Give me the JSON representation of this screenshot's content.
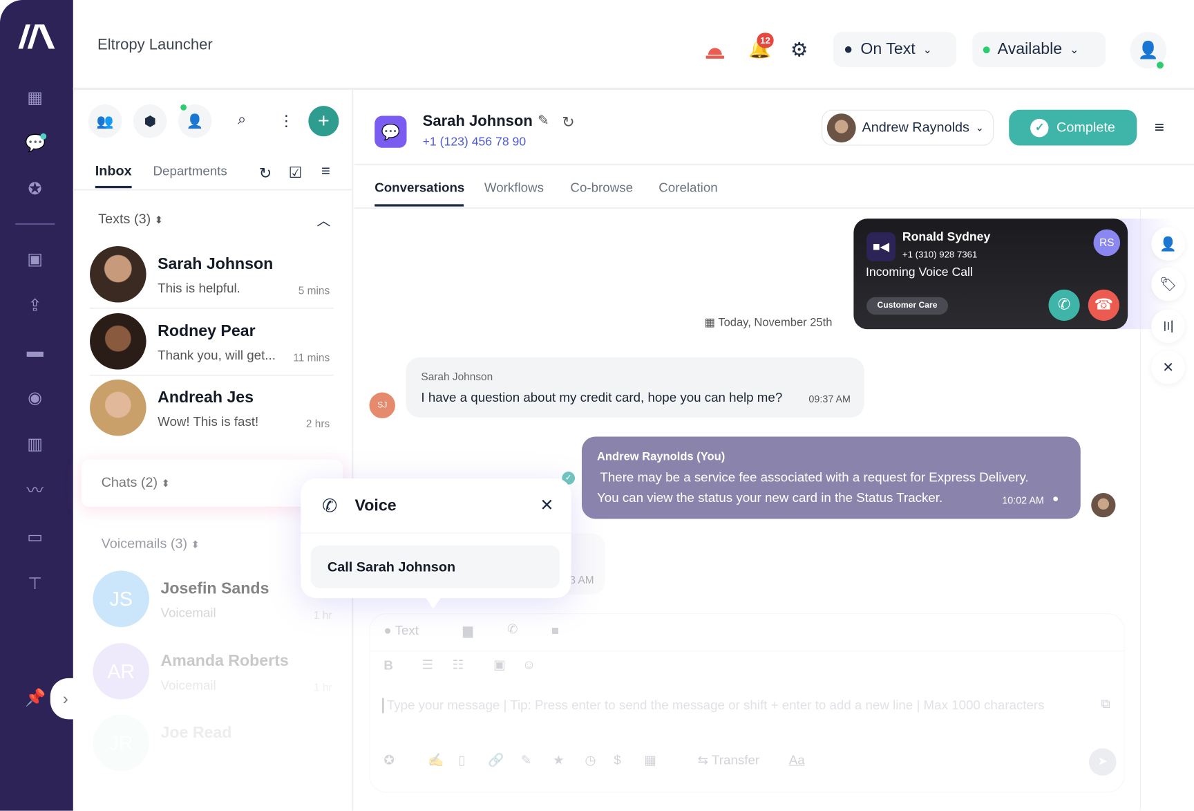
{
  "app": {
    "title": "Eltropy Launcher"
  },
  "header": {
    "notification_count": "12",
    "channel_mode": "On Text",
    "status": "Available",
    "status_color": "#2ecc71"
  },
  "left_panel": {
    "tabs": [
      "Inbox",
      "Departments"
    ],
    "texts_section": "Texts (3)",
    "texts": [
      {
        "name": "Sarah Johnson",
        "message": "This is helpful.",
        "time": "5 mins"
      },
      {
        "name": "Rodney Pear",
        "message": "Thank you, will get...",
        "time": "11 mins"
      },
      {
        "name": "Andreah Jes",
        "message": "Wow! This is fast!",
        "time": "2 hrs"
      }
    ],
    "chats_section": "Chats (2)",
    "voicemails_section": "Voicemails (3)",
    "voicemails": [
      {
        "initials": "JS",
        "name": "Josefin Sands",
        "message": "Voicemail",
        "time": "1 hr"
      },
      {
        "initials": "AR",
        "name": "Amanda Roberts",
        "message": "Voicemail",
        "time": "1 hr"
      },
      {
        "initials": "JR",
        "name": "Joe Read"
      }
    ]
  },
  "conversation": {
    "contact_name": "Sarah Johnson",
    "contact_phone": "+1 (123) 456 78 90",
    "agent": "Andrew Raynolds",
    "complete_label": "Complete",
    "tabs": [
      "Conversations",
      "Workflows",
      "Co-browse",
      "Corelation"
    ],
    "date_label": "Today, November 25th",
    "messages": [
      {
        "initials": "SJ",
        "sender": "Sarah Johnson",
        "text": "I have a question about my credit card, hope you can help me?",
        "time": "09:37 AM"
      },
      {
        "sender": "Andrew Raynolds (You)",
        "text1": "There may be a service fee associated with a request for Express Delivery.",
        "text2": "You can view the status your new card in the Status Tracker.",
        "time": "10:02 AM"
      },
      {
        "time": "3 AM"
      }
    ]
  },
  "incoming_call": {
    "name": "Ronald Sydney",
    "phone": "+1 (310) 928 7361",
    "initials": "RS",
    "label": "Incoming Voice Call",
    "queue": "Customer Care"
  },
  "voice_popup": {
    "title": "Voice",
    "action": "Call Sarah Johnson"
  },
  "composer": {
    "channel": "Text",
    "placeholder": "Type your message | Tip: Press enter to send the message or shift + enter to add a new line | Max 1000 characters",
    "transfer": "Transfer",
    "font_label": "Aa",
    "bold": "B"
  },
  "colors": {
    "sidebar": "#2d2357",
    "accent": "#3fb5a9",
    "end_call": "#ec5b50",
    "link": "#4f5bd5"
  }
}
